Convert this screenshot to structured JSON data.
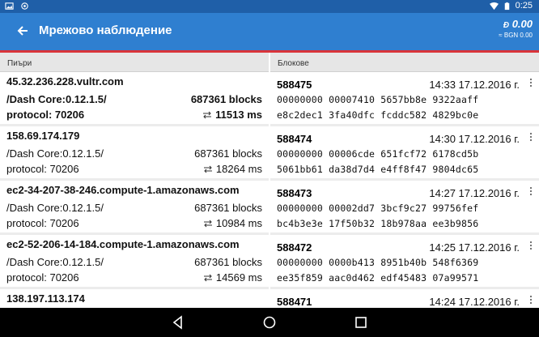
{
  "status": {
    "time": "0:25",
    "icons": [
      "image-icon",
      "sync-icon",
      "wifi-icon",
      "battery-icon"
    ]
  },
  "appbar": {
    "title": "Мрежово наблюдение",
    "balance": "0.00",
    "balance_sub": "≈ BGN 0.00",
    "currency_symbol": "Đ"
  },
  "peers": {
    "header": "Пиъри",
    "items": [
      {
        "host": "45.32.236.228.vultr.com",
        "agent": "/Dash Core:0.12.1.5/",
        "blocks": "687361 blocks",
        "protocol": "protocol: 70206",
        "ping": "11513 ms",
        "bold": true
      },
      {
        "host": "158.69.174.179",
        "agent": "/Dash Core:0.12.1.5/",
        "blocks": "687361 blocks",
        "protocol": "protocol: 70206",
        "ping": "18264 ms",
        "bold": false
      },
      {
        "host": "ec2-34-207-38-246.compute-1.amazonaws.com",
        "agent": "/Dash Core:0.12.1.5/",
        "blocks": "687361 blocks",
        "protocol": "protocol: 70206",
        "ping": "10984 ms",
        "bold": false
      },
      {
        "host": "ec2-52-206-14-184.compute-1.amazonaws.com",
        "agent": "/Dash Core:0.12.1.5/",
        "blocks": "687361 blocks",
        "protocol": "protocol: 70206",
        "ping": "14569 ms",
        "bold": false
      },
      {
        "host": "138.197.113.174",
        "agent": "",
        "blocks": "",
        "protocol": "",
        "ping": "",
        "bold": false
      }
    ]
  },
  "blocks": {
    "header": "Блокове",
    "items": [
      {
        "height": "588475",
        "time": "14:33 17.12.2016 г.",
        "hash1": "00000000 00007410 5657bb8e 9322aaff",
        "hash2": "e8c2dec1 3fa40dfc fcddc582 4829bc0e"
      },
      {
        "height": "588474",
        "time": "14:30 17.12.2016 г.",
        "hash1": "00000000 00006cde 651fcf72 6178cd5b",
        "hash2": "5061bb61 da38d7d4 e4ff8f47 9804dc65"
      },
      {
        "height": "588473",
        "time": "14:27 17.12.2016 г.",
        "hash1": "00000000 00002dd7 3bcf9c27 99756fef",
        "hash2": "bc4b3e3e 17f50b32 18b978aa ee3b9856"
      },
      {
        "height": "588472",
        "time": "14:25 17.12.2016 г.",
        "hash1": "00000000 0000b413 8951b40b 548f6369",
        "hash2": "ee35f859 aac0d462 edf45483 07a99571"
      },
      {
        "height": "588471",
        "time": "14:24 17.12.2016 г.",
        "hash1": "",
        "hash2": ""
      }
    ]
  },
  "colors": {
    "appbar": "#2f7fd0",
    "statusbar": "#1f5fa8",
    "accent_line": "#d9343a"
  }
}
